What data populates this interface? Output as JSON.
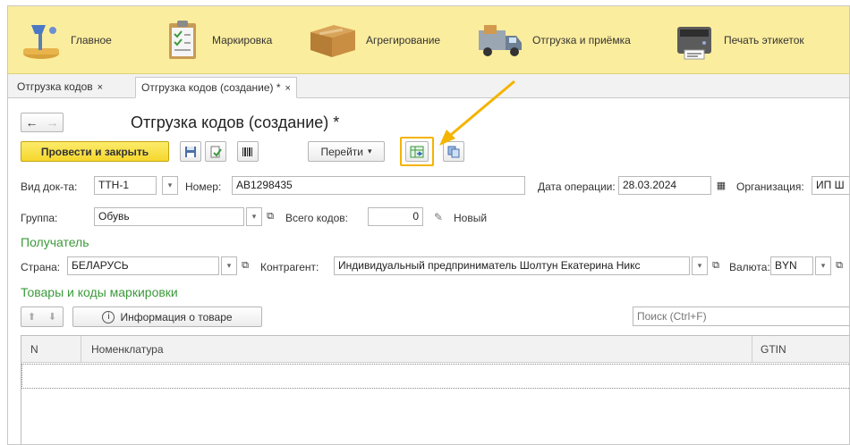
{
  "sections": [
    {
      "label": "Главное",
      "icon": "desk-lamp-icon"
    },
    {
      "label": "Маркировка",
      "icon": "clipboard-checklist-icon"
    },
    {
      "label": "Агрегирование",
      "icon": "cardboard-box-icon"
    },
    {
      "label": "Отгрузка и приёмка",
      "icon": "delivery-truck-icon"
    },
    {
      "label": "Печать этикеток",
      "icon": "label-printer-icon"
    }
  ],
  "tabs": [
    {
      "label": "Отгрузка кодов",
      "close": "×"
    },
    {
      "label": "Отгрузка кодов (создание) *",
      "close": "×"
    }
  ],
  "form": {
    "title": "Отгрузка кодов (создание) *",
    "post_close_label": "Провести и закрыть",
    "goto_label": "Перейти",
    "doc_type_label": "Вид док-та:",
    "doc_type_value": "ТТН-1",
    "number_label": "Номер:",
    "number_value": "АВ1298435",
    "date_label": "Дата операции:",
    "date_value": "28.03.2024",
    "org_label": "Организация:",
    "org_value": "ИП Ш",
    "group_label": "Группа:",
    "group_value": "Обувь",
    "total_codes_label": "Всего кодов:",
    "total_codes_value": "0",
    "status": "Новый"
  },
  "recipient": {
    "heading": "Получатель",
    "country_label": "Страна:",
    "country_value": "БЕЛАРУСЬ",
    "counterparty_label": "Контрагент:",
    "counterparty_value": "Индивидуальный предприниматель Шолтун Екатерина Никс",
    "currency_label": "Валюта:",
    "currency_value": "BYN"
  },
  "goods": {
    "heading": "Товары и коды маркировки",
    "info_button": "Информация о товаре",
    "search_placeholder": "Поиск (Ctrl+F)",
    "columns": [
      "N",
      "Номенклатура",
      "GTIN"
    ]
  },
  "colors": {
    "topbar": "#fbed9e",
    "primary_button": "#f5d72c",
    "section_heading": "#3b9a3b",
    "highlight": "#f4b400"
  }
}
